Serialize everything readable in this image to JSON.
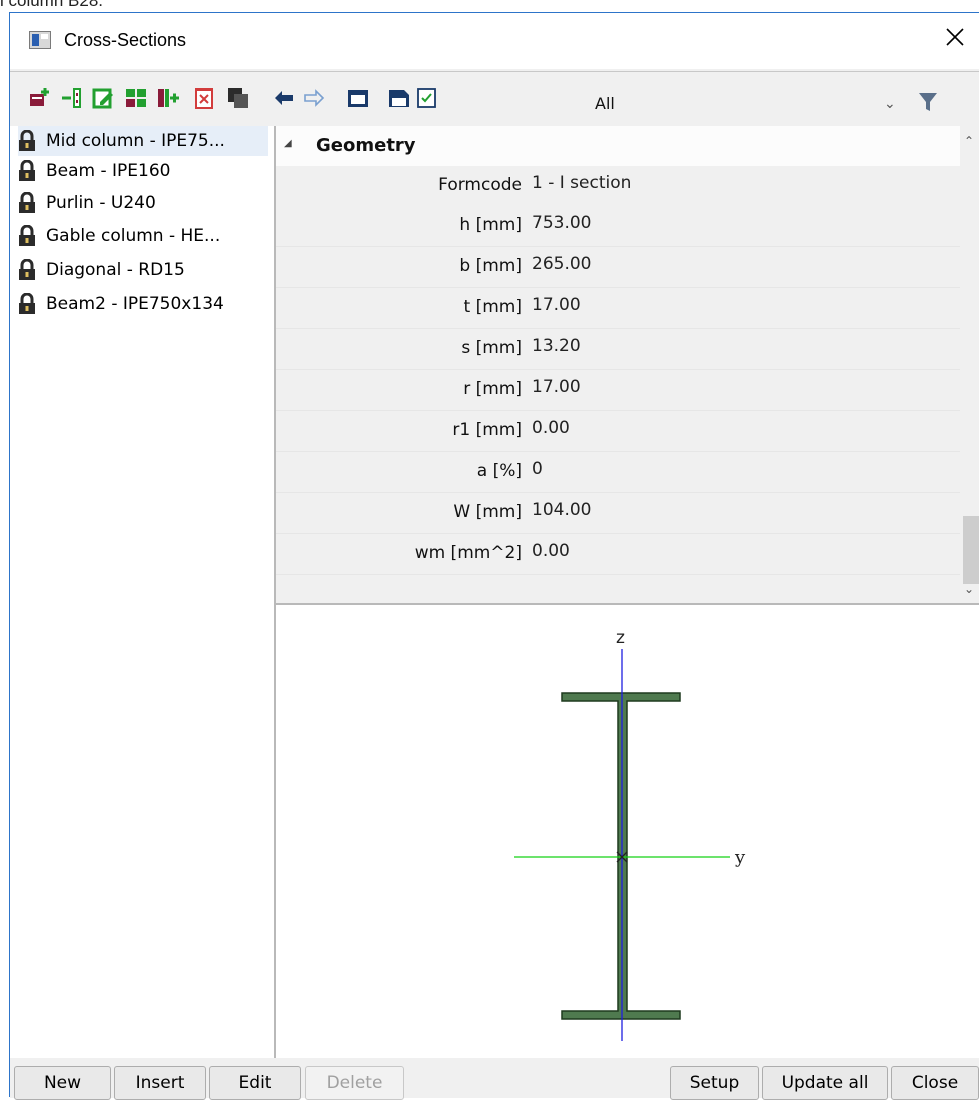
{
  "page_fragment": "l column B28.",
  "window": {
    "title": "Cross-Sections"
  },
  "toolbar": {
    "icons": [
      "new-icon",
      "insert-icon",
      "edit-icon",
      "copy-icon",
      "insert-column-icon",
      "delete-icon",
      "duplicate-icon",
      "undo-icon",
      "redo-icon",
      "table-icon",
      "save-icon",
      "checklist-icon"
    ],
    "filter_value": "All"
  },
  "list": {
    "items": [
      {
        "label": "Mid column - IPE75..."
      },
      {
        "label": "Beam - IPE160"
      },
      {
        "label": "Purlin - U240"
      },
      {
        "label": "Gable column - HE..."
      },
      {
        "label": "Diagonal - RD15"
      },
      {
        "label": "Beam2 - IPE750x134"
      }
    ]
  },
  "properties": {
    "group": "Geometry",
    "rows": [
      {
        "label": "Formcode",
        "value": "1 - I section"
      },
      {
        "label": "h [mm]",
        "value": "753.00"
      },
      {
        "label": "b [mm]",
        "value": "265.00"
      },
      {
        "label": "t [mm]",
        "value": "17.00"
      },
      {
        "label": "s [mm]",
        "value": "13.20"
      },
      {
        "label": "r [mm]",
        "value": "17.00"
      },
      {
        "label": "r1 [mm]",
        "value": "0.00"
      },
      {
        "label": "a [%]",
        "value": "0"
      },
      {
        "label": "W [mm]",
        "value": "104.00"
      },
      {
        "label": "wm [mm^2]",
        "value": "0.00"
      }
    ]
  },
  "preview": {
    "axis_z": "z",
    "axis_y": "y",
    "section_color": "#4f7a4f",
    "axis_color_z": "#1f1fe0",
    "axis_color_y": "#14d214"
  },
  "buttons": {
    "new": "New",
    "insert": "Insert",
    "edit": "Edit",
    "delete": "Delete",
    "setup": "Setup",
    "update_all": "Update all",
    "close": "Close"
  }
}
